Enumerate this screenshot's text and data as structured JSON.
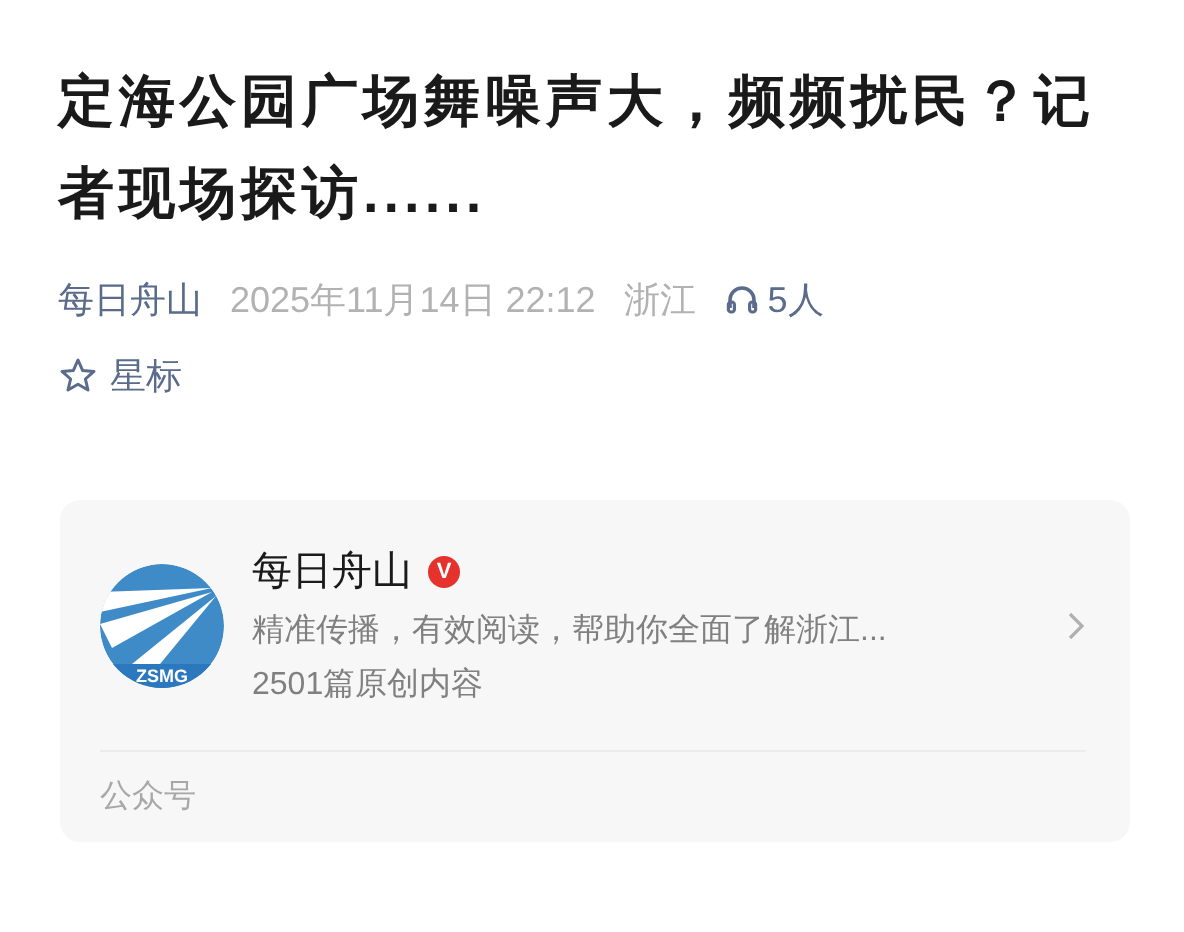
{
  "article": {
    "title": "定海公园广场舞噪声大，频频扰民？记者现场探访......"
  },
  "meta": {
    "account": "每日舟山",
    "date": "2025年11月14日 22:12",
    "location": "浙江",
    "listeners": "5人"
  },
  "star": {
    "label": "星标",
    "checked": false
  },
  "account_card": {
    "logo_text": "ZSMG",
    "name": "每日舟山",
    "verified_badge": "V",
    "description": "精准传播，有效阅读，帮助你全面了解浙江...",
    "count": "2501篇原创内容",
    "footer": "公众号"
  }
}
